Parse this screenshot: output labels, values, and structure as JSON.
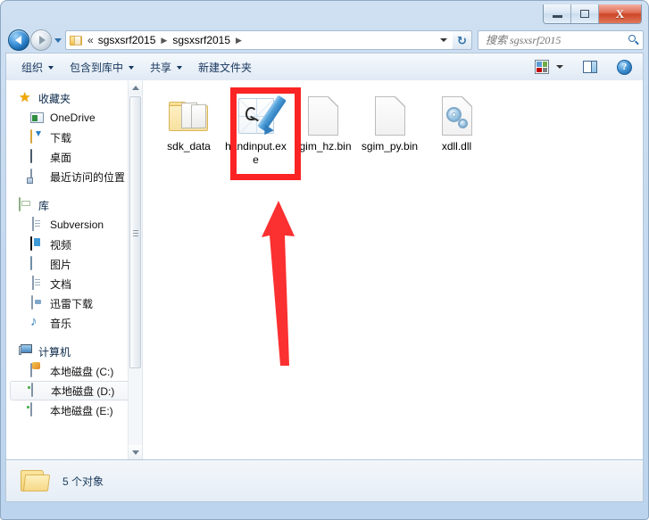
{
  "window": {
    "controls": {
      "minimize": "–",
      "maximize": "□",
      "close": "X"
    }
  },
  "navigation": {
    "back_label": "◀",
    "forward_label": "▶",
    "recent_locations_label": "▾"
  },
  "address": {
    "folder_icon": "folder-icon",
    "overflow_chevrons": "«",
    "crumbs": [
      "sgsxsrf2015",
      "sgsxsrf2015"
    ],
    "separator": "▶",
    "dropdown_label": "▾",
    "refresh_label": "↻"
  },
  "search": {
    "placeholder": "搜索 sgsxsrf2015",
    "value": "",
    "icon": "search-icon"
  },
  "toolbar": {
    "items": [
      {
        "label": "组织",
        "has_caret": true
      },
      {
        "label": "包含到库中",
        "has_caret": true
      },
      {
        "label": "共享",
        "has_caret": true
      },
      {
        "label": "新建文件夹",
        "has_caret": false
      }
    ],
    "views_icon": "views-icon",
    "views_caret": "▾",
    "preview_pane_icon": "preview-pane-icon",
    "help_icon": "help-icon",
    "help_glyph": "?"
  },
  "sidebar": {
    "groups": [
      {
        "header": {
          "label": "收藏夹",
          "icon": "star-icon"
        },
        "items": [
          {
            "label": "OneDrive",
            "icon": "onedrive-icon",
            "selected": false
          },
          {
            "label": "下载",
            "icon": "downloads-folder-icon",
            "selected": false
          },
          {
            "label": "桌面",
            "icon": "desktop-icon",
            "selected": false
          },
          {
            "label": "最近访问的位置",
            "icon": "recent-places-icon",
            "selected": false
          }
        ]
      },
      {
        "header": {
          "label": "库",
          "icon": "library-icon"
        },
        "items": [
          {
            "label": "Subversion",
            "icon": "document-icon",
            "selected": false
          },
          {
            "label": "视频",
            "icon": "video-icon",
            "selected": false
          },
          {
            "label": "图片",
            "icon": "picture-icon",
            "selected": false
          },
          {
            "label": "文档",
            "icon": "document-icon",
            "selected": false
          },
          {
            "label": "迅雷下载",
            "icon": "xunlei-icon",
            "selected": false
          },
          {
            "label": "音乐",
            "icon": "music-icon",
            "selected": false
          }
        ]
      },
      {
        "header": {
          "label": "计算机",
          "icon": "computer-icon"
        },
        "items": [
          {
            "label": "本地磁盘 (C:)",
            "icon": "system-disk-icon",
            "selected": false
          },
          {
            "label": "本地磁盘 (D:)",
            "icon": "disk-icon",
            "selected": true
          },
          {
            "label": "本地磁盘 (E:)",
            "icon": "disk-icon",
            "selected": false
          }
        ]
      }
    ],
    "scrollbar": {
      "up_arrow": "▲",
      "down_arrow": "▼"
    }
  },
  "files": [
    {
      "name": "sdk_data",
      "icon": "folder-icon",
      "highlighted": false
    },
    {
      "name": "handinput.exe",
      "icon": "handwriting-pen-icon",
      "highlighted": true
    },
    {
      "name": "sgim_hz.bin",
      "icon": "blank-file-icon",
      "highlighted": false
    },
    {
      "name": "sgim_py.bin",
      "icon": "blank-file-icon",
      "highlighted": false
    },
    {
      "name": "xdll.dll",
      "icon": "dll-gears-icon",
      "highlighted": false
    }
  ],
  "annotations": {
    "highlight_color": "#fb2424",
    "arrow_color": "#fb3030",
    "highlight_target": "handinput.exe",
    "arrow_direction": "up"
  },
  "statusbar": {
    "icon": "folder-icon",
    "text": "5 个对象"
  }
}
